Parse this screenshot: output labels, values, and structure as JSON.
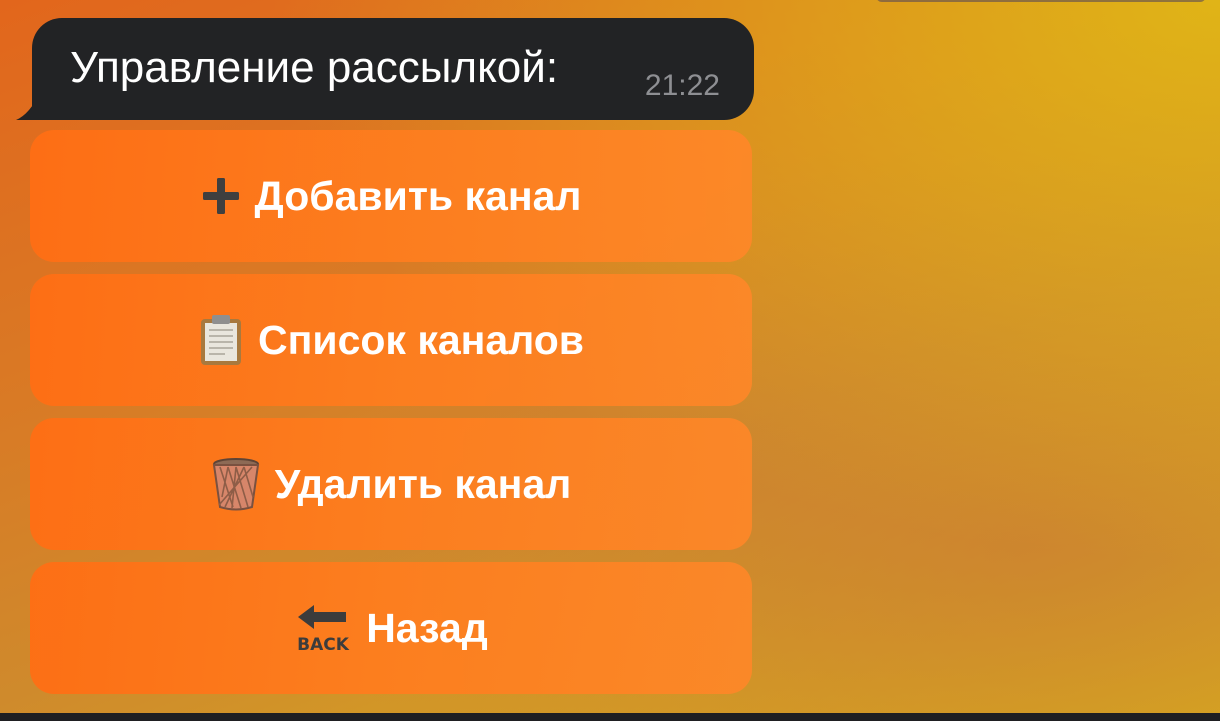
{
  "message": {
    "text": "Управление рассылкой:",
    "time": "21:22"
  },
  "keyboard": [
    {
      "label": "Добавить канал",
      "icon": "plus-icon"
    },
    {
      "label": "Список каналов",
      "icon": "clipboard-icon"
    },
    {
      "label": "Удалить канал",
      "icon": "wastebasket-icon"
    },
    {
      "label": "Назад",
      "icon": "back-arrow-icon",
      "icon_text": "BACK"
    }
  ],
  "colors": {
    "bubble": "#222325",
    "button": "#ff7a1e",
    "button_text": "#ffffff",
    "time": "#8e8f93"
  }
}
